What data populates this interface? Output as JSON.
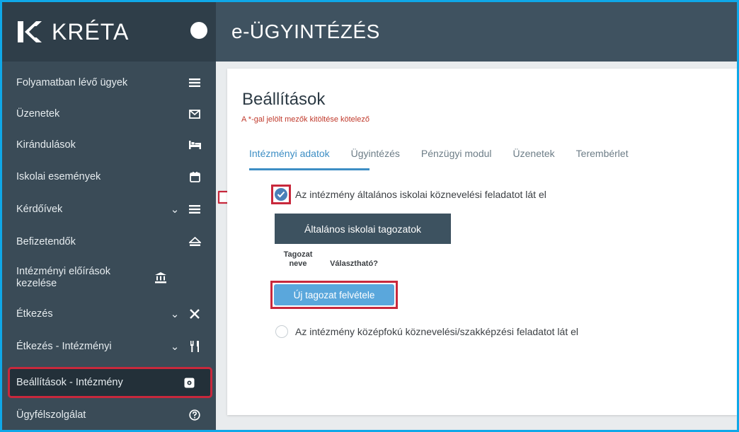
{
  "app": {
    "logo_text": "KRÉTA",
    "title": "e-ÜGYINTÉZÉS"
  },
  "sidebar": {
    "items": [
      {
        "label": "Folyamatban lévő ügyek",
        "icon": "list-icon",
        "chevron": false
      },
      {
        "label": "Üzenetek",
        "icon": "envelope-icon",
        "chevron": false
      },
      {
        "label": "Kirándulások",
        "icon": "bed-icon",
        "chevron": false
      },
      {
        "label": "Iskolai események",
        "icon": "calendar-icon",
        "chevron": false
      },
      {
        "label": "Kérdőívek",
        "icon": "list-icon",
        "chevron": true
      },
      {
        "label": "Befizetendők",
        "icon": "money-icon",
        "chevron": false
      },
      {
        "label": "Intézményi előírások kezelése",
        "icon": "institution-icon",
        "chevron": false
      },
      {
        "label": "Étkezés",
        "icon": "utensils-cross-icon",
        "chevron": true
      },
      {
        "label": "Étkezés - Intézményi",
        "icon": "cutlery-icon",
        "chevron": true
      },
      {
        "label": "Beállítások - Intézmény",
        "icon": "settings-icon",
        "chevron": false,
        "active": true
      },
      {
        "label": "Ügyfélszolgálat",
        "icon": "help-icon",
        "chevron": false
      }
    ]
  },
  "main": {
    "title": "Beállítások",
    "required_note": "A *-gal jelölt mezők kitöltése kötelező",
    "tabs": [
      "Intézményi adatok",
      "Ügyintézés",
      "Pénzügyi modul",
      "Üzenetek",
      "Terembérlet"
    ],
    "active_tab": "Intézményi adatok",
    "checkbox_primary": {
      "label": "Az intézmény általános iskolai köznevelési feladatot lát el",
      "checked": true
    },
    "section_button": "Általános iskolai tagozatok",
    "table_headers": [
      "Tagozat neve",
      "Választható?"
    ],
    "new_button": "Új tagozat felvétele",
    "checkbox_secondary": {
      "label": "Az intézmény középfokú köznevelési/szakképzési feladatot lát el",
      "checked": false
    }
  },
  "colors": {
    "sidebar": "#3a4b57",
    "topbar": "#3f5260",
    "accent": "#3d8ec4",
    "highlight": "#c8283c"
  }
}
